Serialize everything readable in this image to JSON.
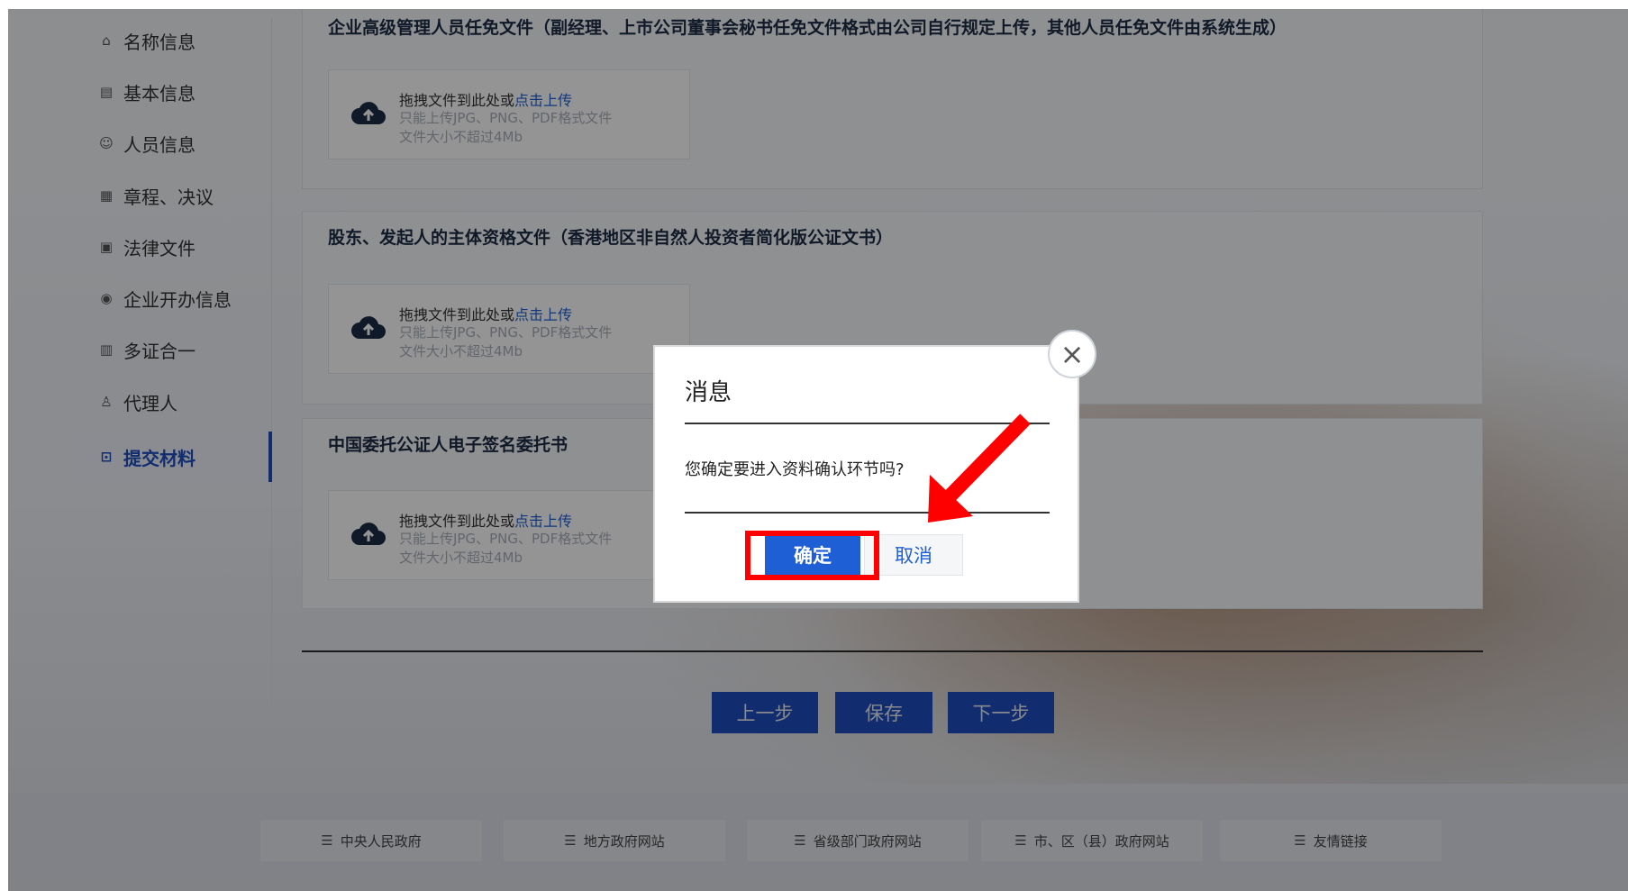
{
  "sidebar": {
    "items": [
      {
        "label": "名称信息",
        "icon": "building-icon"
      },
      {
        "label": "基本信息",
        "icon": "list-icon"
      },
      {
        "label": "人员信息",
        "icon": "people-icon"
      },
      {
        "label": "章程、决议",
        "icon": "document-icon"
      },
      {
        "label": "法律文件",
        "icon": "file-icon"
      },
      {
        "label": "企业开办信息",
        "icon": "badge-icon"
      },
      {
        "label": "多证合一",
        "icon": "certificate-icon"
      },
      {
        "label": "代理人",
        "icon": "person-icon"
      },
      {
        "label": "提交材料",
        "icon": "upload-icon",
        "active": true
      }
    ]
  },
  "sections": [
    {
      "title": "企业高级管理人员任免文件（副经理、上市公司董事会秘书任免文件格式由公司自行规定上传，其他人员任免文件由系统生成）",
      "upload": {
        "drag_text": "拖拽文件到此处或",
        "link_text": "点击上传",
        "format_hint": "只能上传JPG、PNG、PDF格式文件",
        "size_hint": "文件大小不超过4Mb"
      }
    },
    {
      "title": "股东、发起人的主体资格文件（香港地区非自然人投资者简化版公证文书）",
      "upload": {
        "drag_text": "拖拽文件到此处或",
        "link_text": "点击上传",
        "format_hint": "只能上传JPG、PNG、PDF格式文件",
        "size_hint": "文件大小不超过4Mb"
      }
    },
    {
      "title": "中国委托公证人电子签名委托书",
      "upload": {
        "drag_text": "拖拽文件到此处或",
        "link_text": "点击上传",
        "format_hint": "只能上传JPG、PNG、PDF格式文件",
        "size_hint": "文件大小不超过4Mb"
      }
    }
  ],
  "actions": {
    "prev": "上一步",
    "save": "保存",
    "next": "下一步"
  },
  "footer": {
    "links": [
      {
        "label": "中央人民政府",
        "icon": "list-icon"
      },
      {
        "label": "地方政府网站",
        "icon": "list-icon"
      },
      {
        "label": "省级部门政府网站",
        "icon": "list-icon"
      },
      {
        "label": "市、区（县）政府网站",
        "icon": "list-icon"
      },
      {
        "label": "友情链接",
        "icon": "list-icon"
      }
    ]
  },
  "dialog": {
    "title": "消息",
    "message": "您确定要进入资料确认环节吗?",
    "confirm": "确定",
    "cancel": "取消",
    "close_icon": "close-icon"
  },
  "annotation": {
    "highlight_color": "#ff0000",
    "arrow_color": "#ff0000"
  },
  "colors": {
    "primary": "#1f5fd6",
    "nav_active": "#1f4fbf"
  }
}
